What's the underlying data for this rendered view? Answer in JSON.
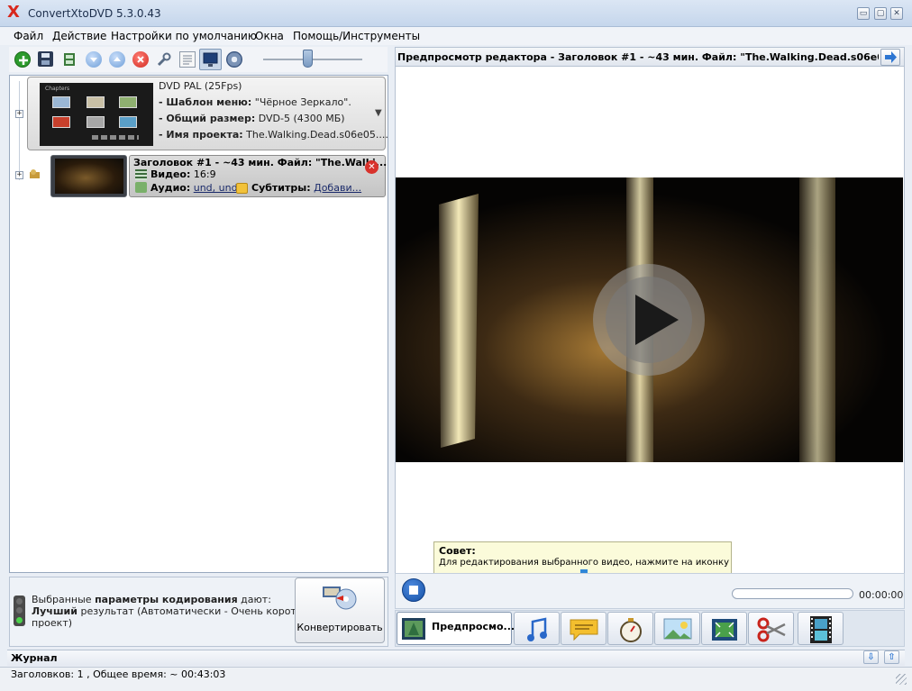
{
  "window": {
    "title": "ConvertXtoDVD 5.3.0.43",
    "logo": "X",
    "controls": [
      "▭",
      "▢",
      "✕"
    ]
  },
  "menu": [
    "Файл",
    "Действие",
    "Настройки по умолчанию",
    "Окна",
    "Помощь/Инструменты"
  ],
  "toolbar": {
    "icons": [
      "add-icon",
      "save-icon",
      "film-split-icon",
      "move-down-icon",
      "move-up-icon",
      "delete-icon",
      "wrench-icon",
      "text-view-icon",
      "monitor-icon",
      "disc-eye-icon"
    ],
    "zoom_slider_value": 0.45
  },
  "dvd": {
    "menu_thumb_label": "Chapters",
    "format": "DVD PAL (25Fps)",
    "menu_template_label": "- Шаблон меню:",
    "menu_template_value": "\"Чёрное Зеркало\".",
    "total_size_label": "- Общий размер:",
    "total_size_value": "DVD-5 (4300 МБ)",
    "project_name_label": "- Имя проекта:",
    "project_name_value": "The.Walking.Dead.s06e05...."
  },
  "title_item": {
    "heading": "Заголовок #1 - ~43 мин. Файл: \"The.Walki...",
    "video_label": "Видео:",
    "video_value": "16:9",
    "audio_label": "Аудио:",
    "audio_value": "und, und",
    "subtitles_label": "Субтитры:",
    "subtitles_value": "Добави..."
  },
  "encoding": {
    "line1_pre": "Выбранные ",
    "line1_bold": "параметры кодирования",
    "line1_post": " дают:",
    "line2_bold": "Лучший",
    "line2_post": " результат (Автоматически - Очень короткий",
    "line3": "проект)"
  },
  "convert_button": "Конвертировать",
  "preview": {
    "header": "Предпросмотр редактора - Заголовок #1 - ~43 мин. Файл: \"The.Walking.Dead.s06e05.WEBDL",
    "time": "00:00:00"
  },
  "tip": {
    "title": "Совет:",
    "text": "Для редактирования выбранного видео, нажмите на иконку"
  },
  "tabs": {
    "preview_label": "Предпросмо...",
    "icons": [
      "preview-icon",
      "music-icon",
      "subtitles-icon",
      "stopwatch-icon",
      "picture-icon",
      "crop-icon",
      "scissors-icon",
      "film-icon"
    ]
  },
  "log": {
    "label": "Журнал"
  },
  "status": "Заголовков: 1 , Общее время: ~ 00:43:03"
}
